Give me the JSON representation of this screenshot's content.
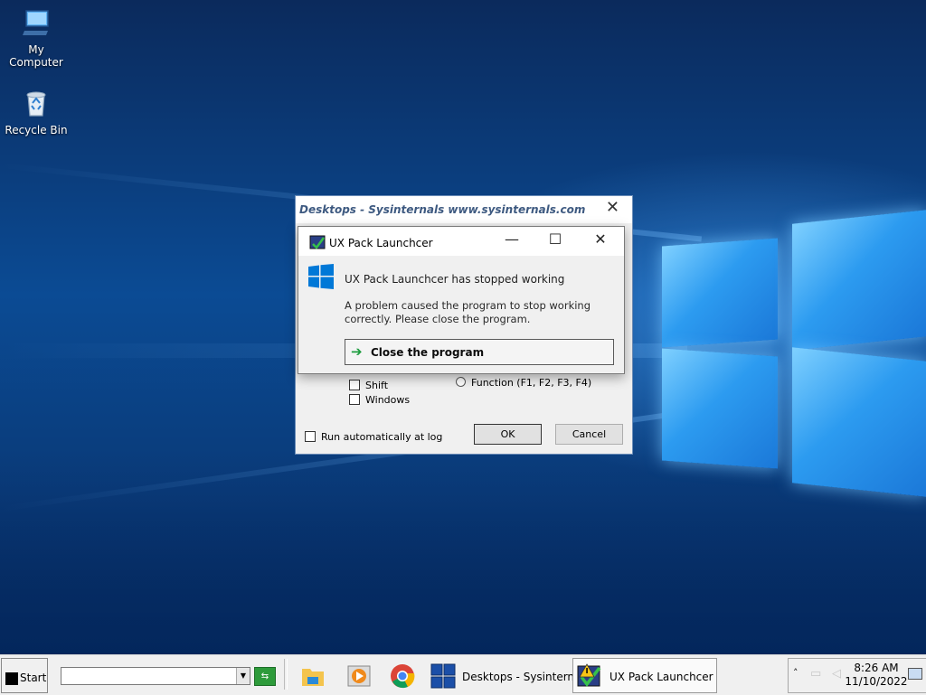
{
  "desktop": {
    "icons": [
      {
        "label": "My Computer"
      },
      {
        "label": "Recycle Bin"
      }
    ]
  },
  "bg_dialog": {
    "title": "Desktops - Sysinternals www.sysinternals.com",
    "checkbox_shift": "Shift",
    "checkbox_windows": "Windows",
    "radio_function": "Function (F1, F2, F3, F4)",
    "checkbox_run": "Run automatically at logon",
    "ok_label": "OK",
    "cancel_label": "Cancel"
  },
  "crash_dialog": {
    "title": "UX Pack Launchcer",
    "heading": "UX Pack Launchcer has stopped working",
    "description": "A problem caused the program to stop working correctly. Please close the program.",
    "close_program_label": "Close the program"
  },
  "taskbar": {
    "start_label": "Start",
    "combo_value": "",
    "buttons": [
      {
        "label": "Desktops - Sysintern..."
      },
      {
        "label": "UX Pack Launchcer"
      }
    ],
    "clock_time": "8:26 AM",
    "clock_date": "11/10/2022"
  },
  "colors": {
    "accent": "#1b78d8",
    "go_green": "#2e9b3b",
    "windows_blue": "#0078d7"
  }
}
